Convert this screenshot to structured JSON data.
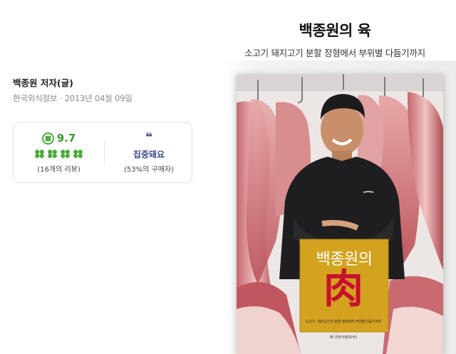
{
  "book": {
    "title": "백종원의 육",
    "subtitle": "소고기 돼지고기 분할 정형에서 부위별 다듬기까지",
    "author": "백종원 저자(글)",
    "publisher_date": "한국외식정보 · 2013년 04월 09일"
  },
  "rating": {
    "score": "9.7",
    "reviews": "(16개의 리뷰)",
    "clover_count": 4,
    "color": "#3d9b2f"
  },
  "tag": {
    "icon": "quote-icon",
    "quote_glyph": "❝",
    "label": "집중돼요",
    "buyers": "(53%의 구매자)",
    "color": "#3d4a8c"
  },
  "cover": {
    "title": "백종원의",
    "big_char": "肉",
    "subtitle": "소고기 · 돼지고기의 분할 정형에서 부위별 다듬기까지",
    "publisher": "㈜ 국외식정보(주)"
  }
}
